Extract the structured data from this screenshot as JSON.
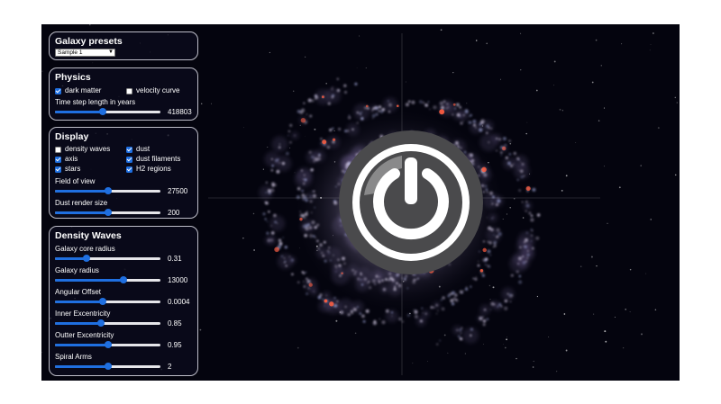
{
  "galaxy_presets": {
    "title": "Galaxy presets",
    "selected": "Sample 1"
  },
  "physics": {
    "title": "Physics",
    "dark_matter": {
      "label": "dark matter",
      "checked": true
    },
    "velocity_curve": {
      "label": "velocity curve",
      "checked": false
    },
    "time_step": {
      "label": "Time step length in years",
      "value": "418803",
      "fraction": 0.45
    }
  },
  "display": {
    "title": "Display",
    "checkboxes": [
      {
        "label": "density waves",
        "checked": false
      },
      {
        "label": "dust",
        "checked": true
      },
      {
        "label": "axis",
        "checked": true
      },
      {
        "label": "dust filaments",
        "checked": true
      },
      {
        "label": "stars",
        "checked": true
      },
      {
        "label": "H2 regions",
        "checked": true
      }
    ],
    "field_of_view": {
      "label": "Field of view",
      "value": "27500",
      "fraction": 0.5
    },
    "dust_render_size": {
      "label": "Dust render size",
      "value": "200",
      "fraction": 0.5
    }
  },
  "density_waves": {
    "title": "Density Waves",
    "sliders": [
      {
        "label": "Galaxy core radius",
        "value": "0.31",
        "fraction": 0.3
      },
      {
        "label": "Galaxy radius",
        "value": "13000",
        "fraction": 0.65
      },
      {
        "label": "Angular Offset",
        "value": "0.0004",
        "fraction": 0.45
      },
      {
        "label": "Inner Excentricity",
        "value": "0.85",
        "fraction": 0.44
      },
      {
        "label": "Outter Excentricity",
        "value": "0.95",
        "fraction": 0.5
      },
      {
        "label": "Spiral Arms",
        "value": "2",
        "fraction": 0.5
      }
    ]
  },
  "overlay": {
    "icon": "power-icon"
  },
  "colors": {
    "accent": "#1f6fe0",
    "background": "#04040e",
    "panel_border": "#bdbdc8"
  }
}
